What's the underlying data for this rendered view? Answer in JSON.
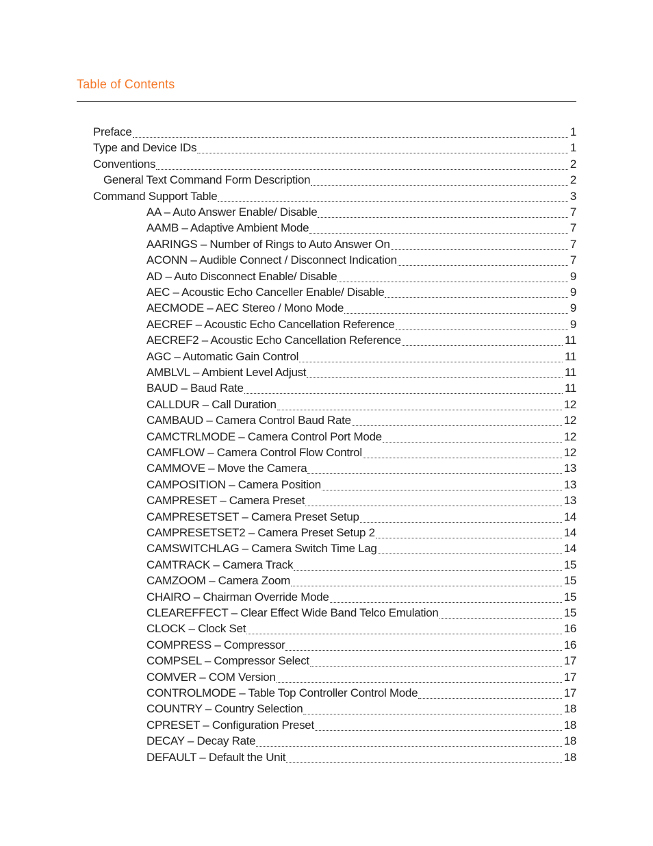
{
  "title": "Table of Contents",
  "colors": {
    "accent": "#f47a2b"
  },
  "entries": [
    {
      "level": 1,
      "label": "Preface",
      "page": "1"
    },
    {
      "level": 1,
      "label": "Type and Device IDs",
      "page": "1"
    },
    {
      "level": 1,
      "label": "Conventions",
      "page": "2"
    },
    {
      "level": 2,
      "label": "General Text Command Form Description",
      "page": "2"
    },
    {
      "level": 1,
      "label": "Command Support Table",
      "page": "3"
    },
    {
      "level": 3,
      "label": "AA – Auto Answer Enable/ Disable",
      "page": "7"
    },
    {
      "level": 3,
      "label": "AAMB – Adaptive Ambient Mode",
      "page": "7"
    },
    {
      "level": 3,
      "label": "AARINGS – Number of Rings to Auto Answer On",
      "page": "7"
    },
    {
      "level": 3,
      "label": "ACONN – Audible Connect / Disconnect Indication",
      "page": "7"
    },
    {
      "level": 3,
      "label": "AD – Auto Disconnect Enable/ Disable",
      "page": "9"
    },
    {
      "level": 3,
      "label": "AEC – Acoustic Echo Canceller Enable/ Disable",
      "page": "9"
    },
    {
      "level": 3,
      "label": "AECMODE – AEC Stereo / Mono Mode",
      "page": "9"
    },
    {
      "level": 3,
      "label": "AECREF – Acoustic Echo Cancellation Reference",
      "page": "9"
    },
    {
      "level": 3,
      "label": "AECREF2 – Acoustic Echo Cancellation Reference",
      "page": "11"
    },
    {
      "level": 3,
      "label": "AGC – Automatic Gain Control",
      "page": "11"
    },
    {
      "level": 3,
      "label": "AMBLVL – Ambient Level Adjust",
      "page": "11"
    },
    {
      "level": 3,
      "label": "BAUD – Baud Rate",
      "page": "11"
    },
    {
      "level": 3,
      "label": "CALLDUR – Call Duration",
      "page": "12"
    },
    {
      "level": 3,
      "label": "CAMBAUD – Camera Control Baud Rate",
      "page": "12"
    },
    {
      "level": 3,
      "label": "CAMCTRLMODE – Camera Control Port Mode",
      "page": "12"
    },
    {
      "level": 3,
      "label": "CAMFLOW – Camera Control Flow Control",
      "page": "12"
    },
    {
      "level": 3,
      "label": "CAMMOVE – Move the Camera",
      "page": "13"
    },
    {
      "level": 3,
      "label": "CAMPOSITION – Camera Position",
      "page": "13"
    },
    {
      "level": 3,
      "label": "CAMPRESET – Camera Preset",
      "page": "13"
    },
    {
      "level": 3,
      "label": "CAMPRESETSET – Camera Preset Setup",
      "page": "14"
    },
    {
      "level": 3,
      "label": "CAMPRESETSET2 – Camera Preset Setup 2",
      "page": "14"
    },
    {
      "level": 3,
      "label": "CAMSWITCHLAG – Camera Switch Time Lag",
      "page": "14"
    },
    {
      "level": 3,
      "label": "CAMTRACK – Camera Track",
      "page": "15"
    },
    {
      "level": 3,
      "label": "CAMZOOM – Camera Zoom",
      "page": "15"
    },
    {
      "level": 3,
      "label": "CHAIRO – Chairman Override Mode",
      "page": "15"
    },
    {
      "level": 3,
      "label": "CLEAREFFECT – Clear Effect Wide Band Telco Emulation",
      "page": "15"
    },
    {
      "level": 3,
      "label": "CLOCK – Clock Set",
      "page": "16"
    },
    {
      "level": 3,
      "label": "COMPRESS – Compressor",
      "page": "16"
    },
    {
      "level": 3,
      "label": "COMPSEL – Compressor Select",
      "page": "17"
    },
    {
      "level": 3,
      "label": "COMVER – COM Version",
      "page": "17"
    },
    {
      "level": 3,
      "label": "CONTROLMODE – Table Top Controller Control Mode",
      "page": "17"
    },
    {
      "level": 3,
      "label": "COUNTRY – Country Selection",
      "page": "18"
    },
    {
      "level": 3,
      "label": "CPRESET – Configuration Preset",
      "page": "18"
    },
    {
      "level": 3,
      "label": "DECAY – Decay Rate",
      "page": "18"
    },
    {
      "level": 3,
      "label": "DEFAULT – Default the Unit",
      "page": "18"
    }
  ]
}
